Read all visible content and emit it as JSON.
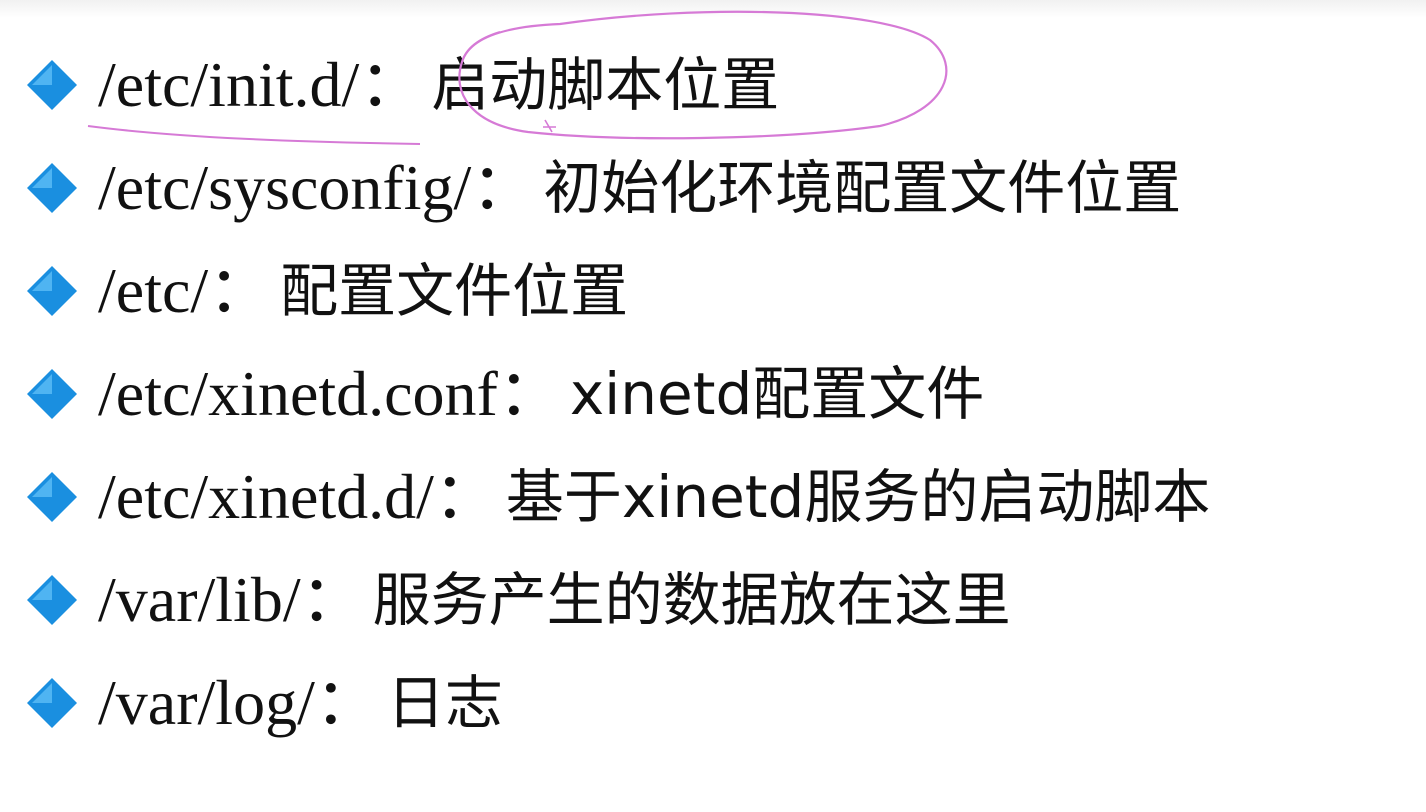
{
  "bullets": [
    {
      "path": "/etc/init.d/：",
      "desc": "启动脚本位置"
    },
    {
      "path": "/etc/sysconfig/：",
      "desc": "初始化环境配置文件位置"
    },
    {
      "path": "/etc/：",
      "desc": "配置文件位置"
    },
    {
      "path": "/etc/xinetd.conf：",
      "desc": "xinetd配置文件"
    },
    {
      "path": "/etc/xinetd.d/：",
      "desc": "基于xinetd服务的启动脚本"
    },
    {
      "path": "/var/lib/：",
      "desc": "服务产生的数据放在这里"
    },
    {
      "path": "/var/log/：",
      "desc": "日志"
    }
  ],
  "colors": {
    "bullet": "#1a8fe0",
    "bullet_highlight": "#4fb4f2",
    "annotation": "#d67ad6",
    "text": "#111111"
  },
  "icons": {
    "bullet": "blue-diamond-bullet-icon"
  }
}
